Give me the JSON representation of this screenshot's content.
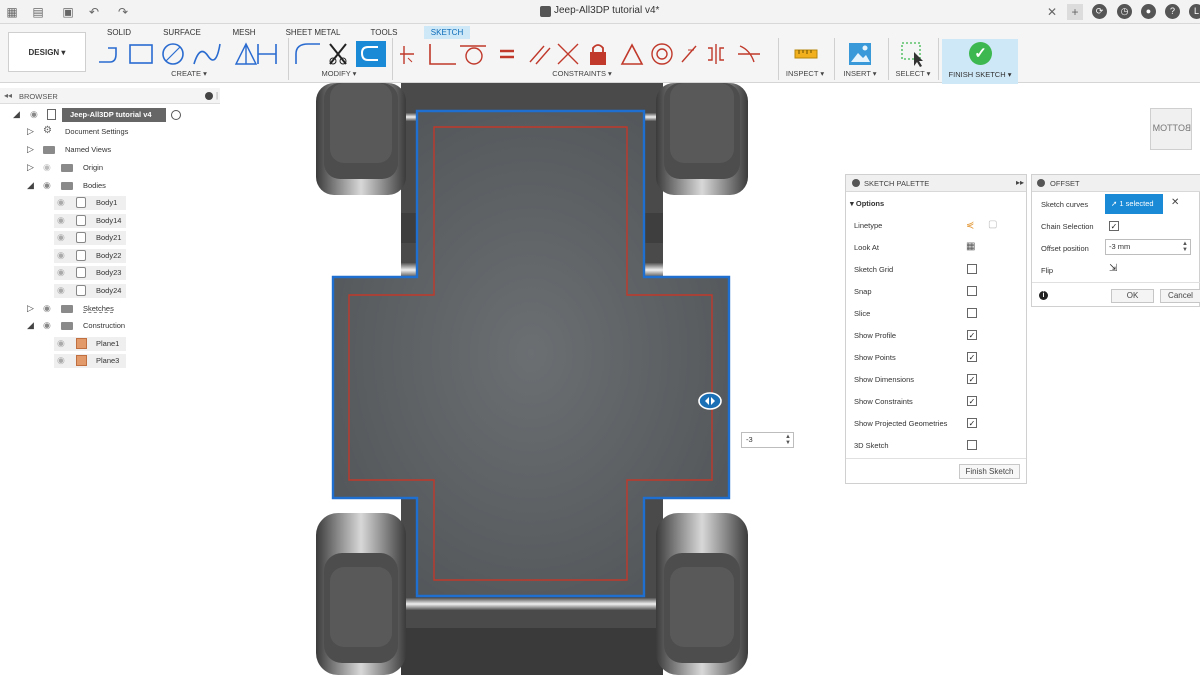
{
  "window": {
    "title": "Jeep-All3DP tutorial v4*"
  },
  "ribbon": {
    "design_label": "DESIGN ▾",
    "tabs": [
      "SOLID",
      "SURFACE",
      "MESH",
      "SHEET METAL",
      "TOOLS",
      "SKETCH"
    ],
    "active_tab": "SKETCH",
    "groups": {
      "create": "CREATE ▾",
      "modify": "MODIFY ▾",
      "constraints": "CONSTRAINTS ▾",
      "inspect": "INSPECT ▾",
      "insert": "INSERT ▾",
      "select": "SELECT ▾",
      "finish": "FINISH SKETCH ▾"
    }
  },
  "browser": {
    "title": "BROWSER",
    "root": "Jeep-All3DP tutorial v4",
    "items": {
      "doc_settings": "Document Settings",
      "named_views": "Named Views",
      "origin": "Origin",
      "bodies": "Bodies",
      "body1": "Body1",
      "body14": "Body14",
      "body21": "Body21",
      "body22": "Body22",
      "body23": "Body23",
      "body24": "Body24",
      "sketches": "Sketches",
      "construction": "Construction",
      "plane1": "Plane1",
      "plane3": "Plane3"
    }
  },
  "palette": {
    "title": "SKETCH PALETTE",
    "options_label": "Options",
    "rows": [
      {
        "label": "Linetype",
        "checked": null
      },
      {
        "label": "Look At",
        "checked": null
      },
      {
        "label": "Sketch Grid",
        "checked": false
      },
      {
        "label": "Snap",
        "checked": false
      },
      {
        "label": "Slice",
        "checked": false
      },
      {
        "label": "Show Profile",
        "checked": true
      },
      {
        "label": "Show Points",
        "checked": true
      },
      {
        "label": "Show Dimensions",
        "checked": true
      },
      {
        "label": "Show Constraints",
        "checked": true
      },
      {
        "label": "Show Projected Geometries",
        "checked": true
      },
      {
        "label": "3D Sketch",
        "checked": false
      }
    ],
    "finish_label": "Finish Sketch"
  },
  "offset": {
    "title": "OFFSET",
    "sketch_curves_label": "Sketch curves",
    "selected_label": "1 selected",
    "chain_label": "Chain Selection",
    "chain_checked": true,
    "position_label": "Offset position",
    "position_value": "-3 mm",
    "flip_label": "Flip",
    "ok_label": "OK",
    "cancel_label": "Cancel"
  },
  "canvas": {
    "dimension_value": "-3",
    "viewcube_label": "BOTTOM"
  },
  "colors": {
    "accent": "#1a8ad6",
    "sketch_blue": "#1e6fd0",
    "offset_red": "#c0392b",
    "finish_green": "#3db74f"
  }
}
